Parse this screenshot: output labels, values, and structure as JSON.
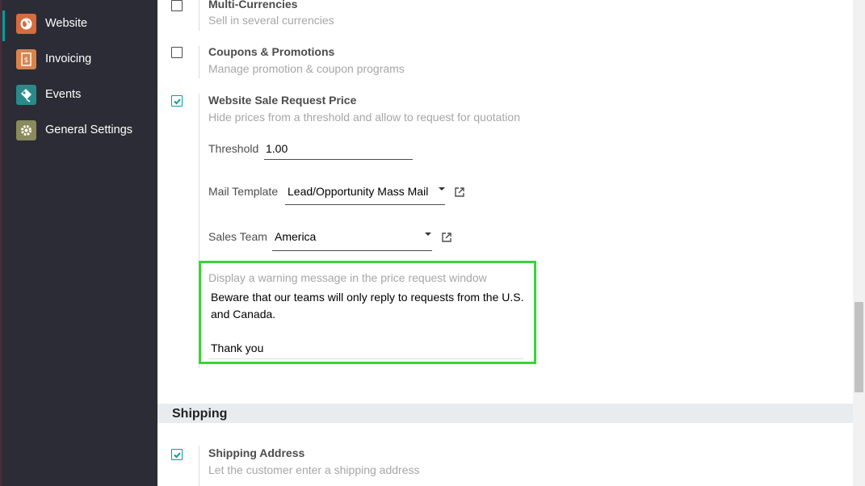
{
  "sidebar": {
    "items": [
      {
        "label": "Website",
        "icon": "website-icon",
        "active": true
      },
      {
        "label": "Invoicing",
        "icon": "invoicing-icon",
        "active": false
      },
      {
        "label": "Events",
        "icon": "events-icon",
        "active": false
      },
      {
        "label": "General Settings",
        "icon": "gear-icon",
        "active": false
      }
    ]
  },
  "settings": {
    "multi_currencies": {
      "title": "Multi-Currencies",
      "desc": "Sell in several currencies",
      "checked": false
    },
    "coupons": {
      "title": "Coupons & Promotions",
      "desc": "Manage promotion & coupon programs",
      "checked": false
    },
    "request_price": {
      "title": "Website Sale Request Price",
      "desc": "Hide prices from a threshold and allow to request for quotation",
      "checked": true,
      "threshold_label": "Threshold",
      "threshold_value": "1.00",
      "mail_template_label": "Mail Template",
      "mail_template_value": "Lead/Opportunity Mass Mail",
      "sales_team_label": "Sales Team",
      "sales_team_value": "America",
      "warning_label": "Display a warning message in the price request window",
      "warning_text": "Beware that our teams will only reply to requests from the U.S. and Canada.\n\nThank you"
    }
  },
  "shipping": {
    "section_title": "Shipping",
    "address": {
      "title": "Shipping Address",
      "desc": "Let the customer enter a shipping address",
      "checked": true
    }
  },
  "colors": {
    "accent": "#00a09d",
    "sidebar_bg": "#2c2c36",
    "highlight_border": "#3cd23a"
  }
}
